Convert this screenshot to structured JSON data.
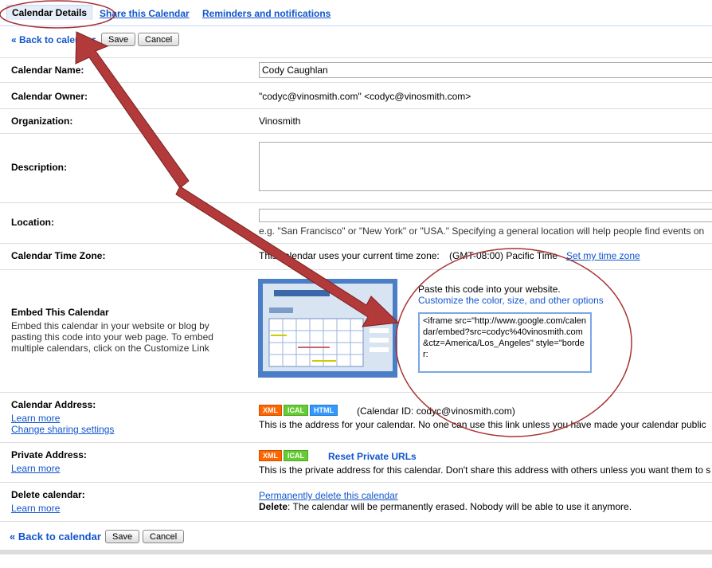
{
  "tabs": [
    {
      "label": "Calendar Details"
    },
    {
      "label": "Share this Calendar"
    },
    {
      "label": "Reminders and notifications"
    }
  ],
  "toolbar": {
    "back": "« Back to calendar",
    "save": "Save",
    "cancel": "Cancel"
  },
  "fields": {
    "name": {
      "label": "Calendar Name:",
      "value": "Cody Caughlan"
    },
    "owner": {
      "label": "Calendar Owner:",
      "value": "\"codyc@vinosmith.com\" <codyc@vinosmith.com>"
    },
    "org": {
      "label": "Organization:",
      "value": "Vinosmith"
    },
    "description": {
      "label": "Description:",
      "value": ""
    },
    "location": {
      "label": "Location:",
      "value": "",
      "hint": "e.g. \"San Francisco\" or \"New York\" or \"USA.\" Specifying a general location will help people find events on"
    },
    "timezone": {
      "label": "Calendar Time Zone:",
      "text": "This calendar uses your current time zone:",
      "zone": "(GMT-08:00) Pacific Time",
      "link": "Set my time zone"
    },
    "embed": {
      "label": "Embed This Calendar",
      "desc": "Embed this calendar in your website or blog by pasting this code into your web page. To embed multiple calendars, click on the Customize Link",
      "paste": "Paste this code into your website.",
      "customize": "Customize the color, size, and other options",
      "code": "<iframe src=\"http://www.google.com/calendar/embed?src=codyc%40vinosmith.com&ctz=America/Los_Angeles\" style=\"border:"
    },
    "address": {
      "label": "Calendar Address:",
      "learn": "Learn more",
      "change": "Change sharing settings",
      "id": "(Calendar ID: codyc@vinosmith.com)",
      "desc": "This is the address for your calendar. No one can use this link unless you have made your calendar public"
    },
    "private": {
      "label": "Private Address:",
      "learn": "Learn more",
      "reset": "Reset Private URLs",
      "desc": "This is the private address for this calendar. Don't share this address with others unless you want them to s"
    },
    "delete": {
      "label": "Delete calendar:",
      "learn": "Learn more",
      "link": "Permanently delete this calendar",
      "bold": "Delete",
      "desc": ": The calendar will be permanently erased. Nobody will be able to use it anymore."
    }
  },
  "badges": {
    "xml": "XML",
    "ical": "ICAL",
    "html": "HTML"
  },
  "bottom": {
    "back": "« Back to calendar",
    "save": "Save",
    "cancel": "Cancel"
  },
  "colors": {
    "link": "#1155cc",
    "annotation": "#a83232"
  }
}
